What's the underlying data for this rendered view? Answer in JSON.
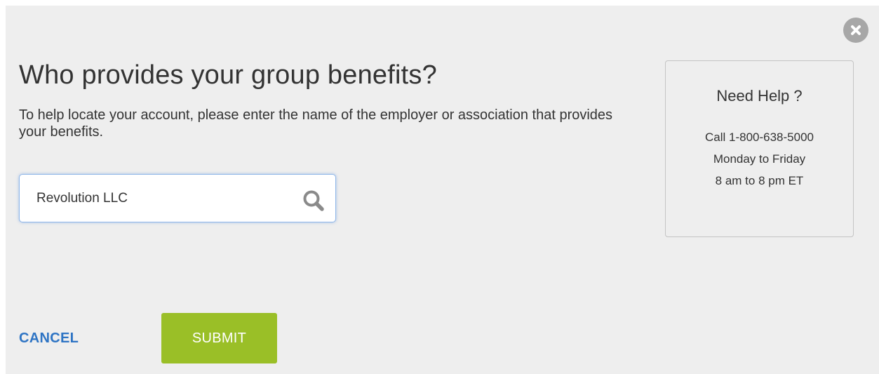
{
  "dialog": {
    "title": "Who provides your group benefits?",
    "description": "To help locate your account, please enter the name of the employer or association that provides your benefits."
  },
  "search": {
    "value": "Revolution LLC",
    "icon": "search-icon"
  },
  "help": {
    "title": "Need Help ?",
    "phone_line": "Call 1-800-638-5000",
    "days_line": "Monday to Friday",
    "hours_line": "8 am to 8 pm ET"
  },
  "actions": {
    "cancel_label": "CANCEL",
    "submit_label": "SUBMIT"
  },
  "colors": {
    "background": "#eeeeee",
    "cancel_link": "#2e74c4",
    "submit_button": "#9abf27",
    "close_button": "#a7a7a7",
    "input_focus_border": "#8fb6e8"
  }
}
